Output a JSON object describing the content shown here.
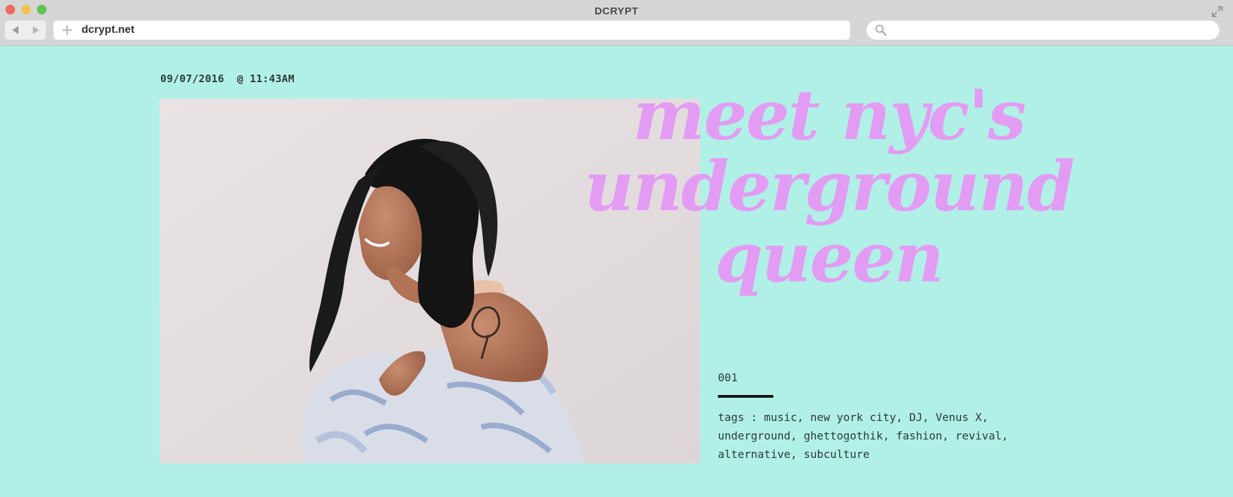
{
  "window": {
    "title": "DCRYPT"
  },
  "toolbar": {
    "url": "dcrypt.net",
    "search_placeholder": ""
  },
  "article": {
    "date": "09/07/2016",
    "time": "@ 11:43AM",
    "headline_line1": "meet nyc's",
    "headline_line2": "underground queen",
    "issue_number": "001",
    "tags": "tags : music, new york city, DJ, Venus X, underground, ghettogothik, fashion, revival, alternative, subculture"
  },
  "colors": {
    "page_background": "#b1f0e6",
    "headline": "#e39cf3",
    "chrome": "#d6d6d6"
  },
  "icons": {
    "close": "red-dot",
    "minimize": "yellow-dot",
    "zoom": "green-dot",
    "back": "triangle-left",
    "forward": "triangle-right",
    "new_tab": "plus",
    "search": "magnifier",
    "fullscreen": "diagonal-arrows"
  }
}
